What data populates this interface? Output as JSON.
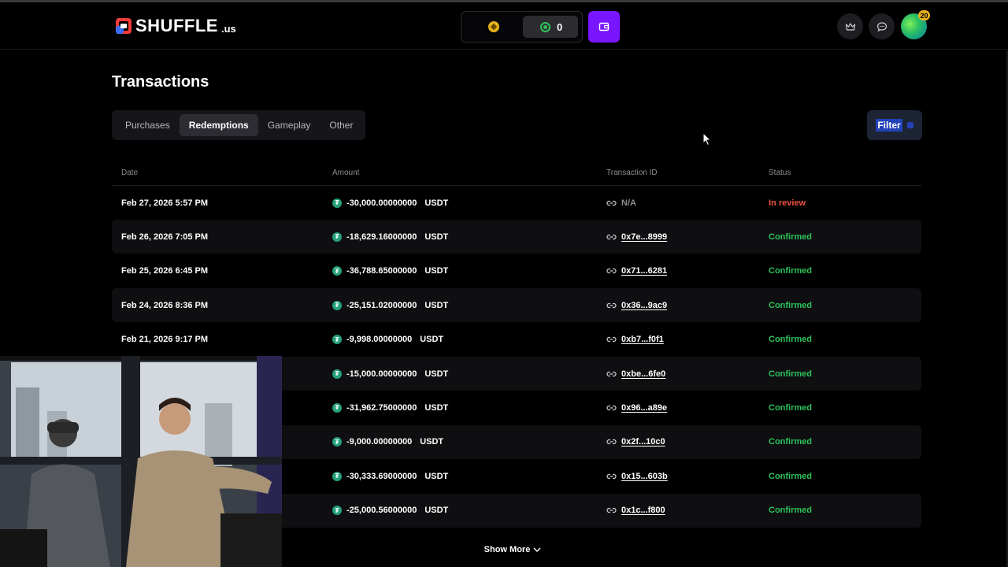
{
  "header": {
    "logo_text": "SHUFFLE",
    "logo_suffix": ".us",
    "balance": "0",
    "level": "20"
  },
  "page": {
    "title": "Transactions"
  },
  "tabs": [
    {
      "label": "Purchases",
      "active": false
    },
    {
      "label": "Redemptions",
      "active": true
    },
    {
      "label": "Gameplay",
      "active": false
    },
    {
      "label": "Other",
      "active": false
    }
  ],
  "filter_label": "Filter",
  "table": {
    "columns": [
      "Date",
      "Amount",
      "Transaction ID",
      "Status"
    ],
    "rows": [
      {
        "date": "Feb 27, 2026 5:57 PM",
        "amount": "-30,000.00000000",
        "currency": "USDT",
        "tx": "N/A",
        "status": "In review"
      },
      {
        "date": "Feb 26, 2026 7:05 PM",
        "amount": "-18,629.16000000",
        "currency": "USDT",
        "tx": "0x7e...8999",
        "status": "Confirmed"
      },
      {
        "date": "Feb 25, 2026 6:45 PM",
        "amount": "-36,788.65000000",
        "currency": "USDT",
        "tx": "0x71...6281",
        "status": "Confirmed"
      },
      {
        "date": "Feb 24, 2026 8:36 PM",
        "amount": "-25,151.02000000",
        "currency": "USDT",
        "tx": "0x36...9ac9",
        "status": "Confirmed"
      },
      {
        "date": "Feb 21, 2026 9:17 PM",
        "amount": "-9,998.00000000",
        "currency": "USDT",
        "tx": "0xb7...f0f1",
        "status": "Confirmed"
      },
      {
        "date": "",
        "amount": "-15,000.00000000",
        "currency": "USDT",
        "tx": "0xbe...6fe0",
        "status": "Confirmed"
      },
      {
        "date": "",
        "amount": "-31,962.75000000",
        "currency": "USDT",
        "tx": "0x96...a89e",
        "status": "Confirmed"
      },
      {
        "date": "",
        "amount": "-9,000.00000000",
        "currency": "USDT",
        "tx": "0x2f...10c0",
        "status": "Confirmed"
      },
      {
        "date": "",
        "amount": "-30,333.69000000",
        "currency": "USDT",
        "tx": "0x15...603b",
        "status": "Confirmed"
      },
      {
        "date": "",
        "amount": "-25,000.56000000",
        "currency": "USDT",
        "tx": "0x1c...f800",
        "status": "Confirmed"
      }
    ]
  },
  "show_more_label": "Show More",
  "colors": {
    "accent_purple": "#7a16ff",
    "status_confirmed": "#2ec25b",
    "status_review": "#f0523f",
    "tether_green": "#26a17b"
  },
  "icons": [
    "shuffle-logo-icon",
    "gold-coin-icon",
    "green-coin-icon",
    "wallet-icon",
    "crown-icon",
    "chat-icon",
    "link-icon",
    "tether-icon",
    "chevron-down-icon",
    "filter-icon"
  ]
}
